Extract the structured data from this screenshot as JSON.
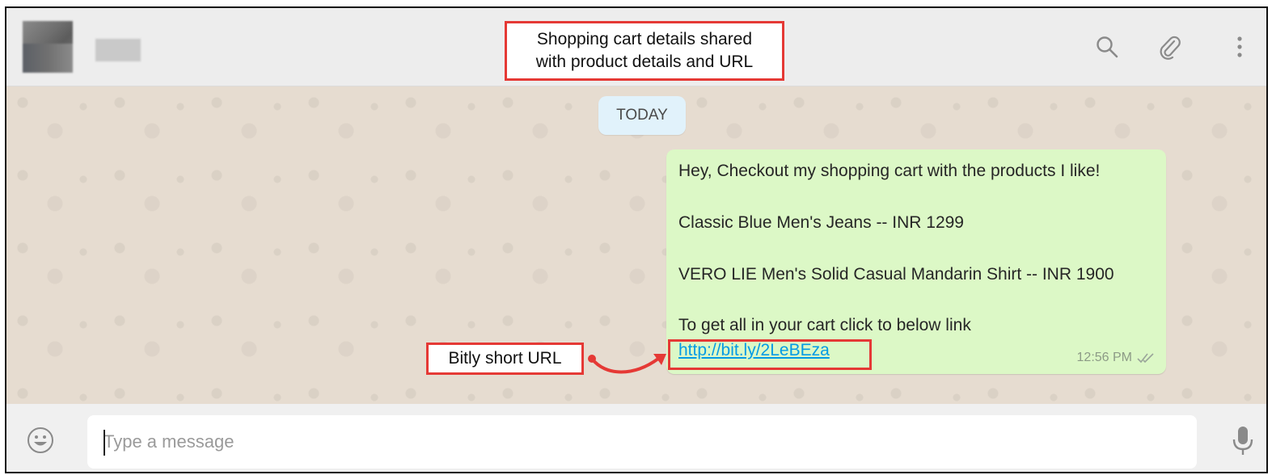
{
  "header": {
    "annotation": [
      "Shopping cart details shared",
      "with product details and URL"
    ]
  },
  "chat": {
    "date_chip": "TODAY",
    "message": {
      "lines": [
        "Hey, Checkout my shopping cart with the products I like!",
        "Classic Blue Men's Jeans -- INR 1299",
        "VERO LIE Men's Solid Casual Mandarin Shirt -- INR 1900",
        "To get all in your cart click to below link"
      ],
      "link": "http://bit.ly/2LeBEza",
      "time": "12:56 PM"
    },
    "annotation": "Bitly short URL"
  },
  "input": {
    "placeholder": "Type a message"
  },
  "icons": {
    "search": "search-icon",
    "attach": "paperclip-icon",
    "menu": "more-vertical-icon",
    "emoji": "emoji-icon",
    "mic": "microphone-icon",
    "read": "double-check-icon"
  },
  "colors": {
    "annotation": "#e53935",
    "bubble": "#dcf8c6",
    "link": "#039be5"
  }
}
